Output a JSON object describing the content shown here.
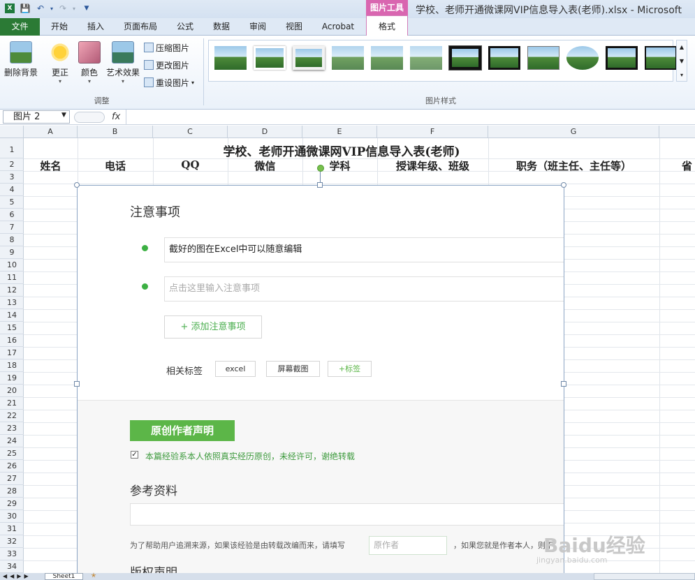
{
  "window": {
    "title": "学校、老师开通微课网VIP信息导入表(老师).xlsx - Microsoft",
    "context_tab_header": "图片工具"
  },
  "ribbon": {
    "tabs": [
      "开始",
      "插入",
      "页面布局",
      "公式",
      "数据",
      "审阅",
      "视图",
      "Acrobat"
    ],
    "file_tab": "文件",
    "format_tab": "格式",
    "remove_bg": "删除背景",
    "corrections": "更正",
    "color": "颜色",
    "artistic": "艺术效果",
    "compress": "压缩图片",
    "change_pic": "更改图片",
    "reset_pic": "重设图片",
    "group_adjust": "调整",
    "group_styles": "图片样式"
  },
  "formula_bar": {
    "name_box": "图片 2",
    "fx": "fx"
  },
  "sheet": {
    "columns": [
      "A",
      "B",
      "C",
      "D",
      "E",
      "F",
      "G"
    ],
    "rows": [
      "1",
      "2",
      "3",
      "4",
      "5",
      "6",
      "7",
      "8",
      "9",
      "10",
      "11",
      "12",
      "13",
      "14",
      "15",
      "16",
      "17",
      "18",
      "19",
      "20",
      "21",
      "22",
      "23",
      "24",
      "25",
      "26",
      "27",
      "28",
      "29",
      "30",
      "31",
      "32",
      "33",
      "34"
    ],
    "title": "学校、老师开通微课网VIP信息导入表(老师)",
    "headers": [
      "姓名",
      "电话",
      "QQ",
      "微信",
      "学科",
      "授课年级、班级",
      "职务（班主任、主任等）",
      "省"
    ],
    "tab_name": "Sheet1"
  },
  "picture": {
    "notes_title": "注意事项",
    "note1": "截好的图在Excel中可以随意编辑",
    "note2_placeholder": "点击这里输入注意事项",
    "add_note": "+ 添加注意事项",
    "tags_label": "相关标签",
    "tags": [
      "excel",
      "屏幕截图",
      "+标签"
    ],
    "original_button": "原创作者声明",
    "original_text": "本篇经验系本人依照真实经历原创，未经许可，谢绝转载",
    "references_title": "参考资料",
    "source_text": "为了帮助用户追溯来源，如果该经验是由转载改编而来，请填写",
    "source_placeholder": "原作者",
    "source_text2": "，如果您就是作者本人，则不",
    "copyright_title": "版权声明"
  },
  "watermark": {
    "brand": "Baidu经验",
    "url": "jingyan.baidu.com"
  },
  "colors": {
    "file_tab": "#2b7a35",
    "context_tab": "#d966b0",
    "green_button": "#5cb648",
    "dot": "#3cb043"
  }
}
